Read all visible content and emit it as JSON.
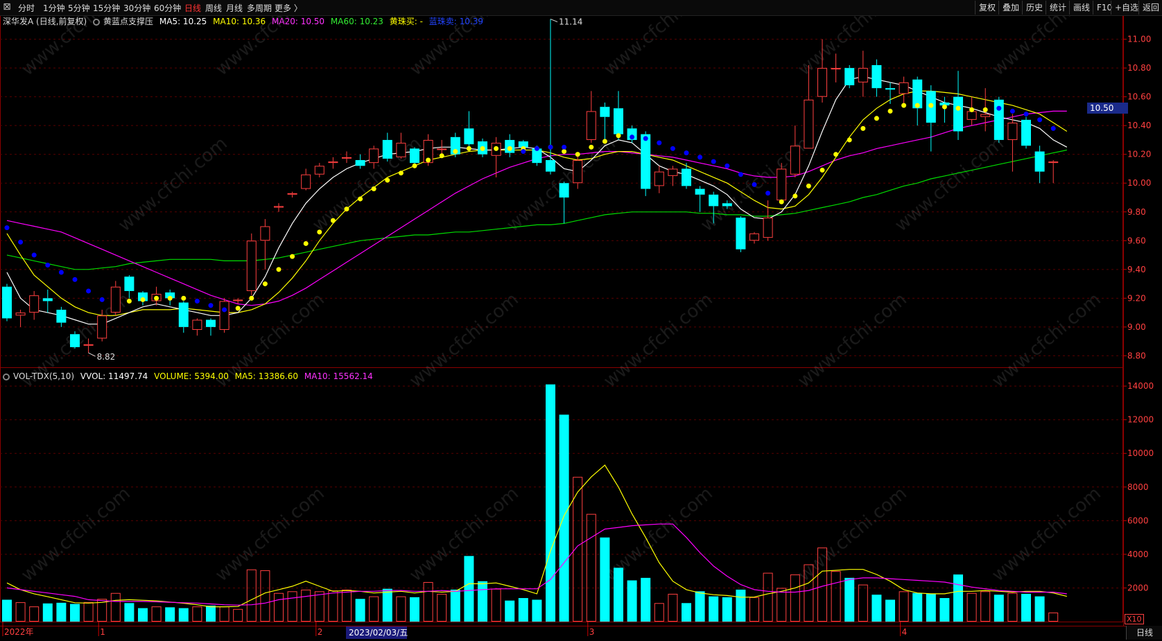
{
  "toolbar": {
    "left_items": [
      "分时",
      "1分钟",
      "5分钟",
      "15分钟",
      "30分钟",
      "60分钟",
      "日线",
      "周线",
      "月线",
      "多周期",
      "更多 〉"
    ],
    "active": "日线",
    "right_items": [
      "复权",
      "叠加",
      "历史",
      "统计",
      "画线",
      "F10",
      "+自选",
      "返回"
    ]
  },
  "price_panel": {
    "stock": "深华发A (日线,前复权)",
    "indicator": "黄蓝点支撑压",
    "ma5": "MA5: 10.25",
    "ma10": "MA10: 10.36",
    "ma20": "MA20: 10.50",
    "ma60": "MA60: 10.23",
    "yellow_buy": "黄珠买: -",
    "blue_sell": "蓝珠卖: 10.39",
    "current_price": "10.50",
    "high_label": "11.14",
    "low_label": "8.82",
    "y_ticks": [
      "11.00",
      "10.80",
      "10.60",
      "10.40",
      "10.20",
      "10.00",
      "9.80",
      "9.60",
      "9.40",
      "9.20",
      "9.00",
      "8.80"
    ]
  },
  "volume_panel": {
    "indicator": "VOL-TDX(5,10)",
    "vvol": "VVOL: 11497.74",
    "volume": "VOLUME: 5394.00",
    "ma5": "MA5: 13386.60",
    "ma10": "MA10: 15562.14",
    "y_ticks": [
      "14000",
      "12000",
      "10000",
      "8000",
      "6000",
      "4000",
      "2000"
    ],
    "x10_label": "X10"
  },
  "x_axis": {
    "labels": [
      "2022年",
      "1",
      "2",
      "3",
      "4"
    ],
    "cursor_date": "2023/02/03/五"
  },
  "bottom_tab": "日线",
  "watermark": "www.cfchi.com",
  "colors": {
    "up": "#ff4040",
    "down": "#00ffff",
    "ma5": "#ffffff",
    "ma10": "#ffff00",
    "ma20": "#ff00ff",
    "ma60": "#00dd00",
    "yellow_dot": "#ffff00",
    "blue_dot": "#0000ff"
  },
  "chart_data": {
    "type": "candlestick",
    "candles": [
      {
        "o": 9.28,
        "c": 9.06,
        "h": 9.3,
        "l": 9.04,
        "v": 1300
      },
      {
        "o": 9.08,
        "c": 9.1,
        "h": 9.12,
        "l": 9.0,
        "v": 1150
      },
      {
        "o": 9.1,
        "c": 9.22,
        "h": 9.25,
        "l": 9.05,
        "v": 900
      },
      {
        "o": 9.2,
        "c": 9.18,
        "h": 9.26,
        "l": 9.1,
        "v": 1080
      },
      {
        "o": 9.12,
        "c": 9.03,
        "h": 9.14,
        "l": 9.0,
        "v": 1120
      },
      {
        "o": 8.95,
        "c": 8.86,
        "h": 8.97,
        "l": 8.85,
        "v": 1050
      },
      {
        "o": 8.87,
        "c": 8.88,
        "h": 8.92,
        "l": 8.82,
        "v": 1160
      },
      {
        "o": 8.92,
        "c": 9.08,
        "h": 9.12,
        "l": 8.9,
        "v": 1350
      },
      {
        "o": 9.1,
        "c": 9.28,
        "h": 9.32,
        "l": 9.08,
        "v": 1700
      },
      {
        "o": 9.35,
        "c": 9.25,
        "h": 9.36,
        "l": 9.2,
        "v": 1100
      },
      {
        "o": 9.24,
        "c": 9.18,
        "h": 9.25,
        "l": 9.15,
        "v": 800
      },
      {
        "o": 9.18,
        "c": 9.23,
        "h": 9.28,
        "l": 9.15,
        "v": 900
      },
      {
        "o": 9.24,
        "c": 9.2,
        "h": 9.26,
        "l": 9.15,
        "v": 850
      },
      {
        "o": 9.17,
        "c": 9.0,
        "h": 9.18,
        "l": 8.96,
        "v": 800
      },
      {
        "o": 8.98,
        "c": 9.05,
        "h": 9.06,
        "l": 8.94,
        "v": 900
      },
      {
        "o": 9.05,
        "c": 9.0,
        "h": 9.06,
        "l": 8.94,
        "v": 950
      },
      {
        "o": 8.98,
        "c": 9.18,
        "h": 9.2,
        "l": 8.96,
        "v": 900
      },
      {
        "o": 9.18,
        "c": 9.19,
        "h": 9.2,
        "l": 9.16,
        "v": 750
      },
      {
        "o": 9.25,
        "c": 9.6,
        "h": 9.65,
        "l": 9.22,
        "v": 3100
      },
      {
        "o": 9.6,
        "c": 9.7,
        "h": 9.75,
        "l": 9.4,
        "v": 3050
      },
      {
        "o": 9.83,
        "c": 9.84,
        "h": 9.86,
        "l": 9.8,
        "v": 1700
      },
      {
        "o": 9.92,
        "c": 9.93,
        "h": 9.94,
        "l": 9.9,
        "v": 1800
      },
      {
        "o": 9.96,
        "c": 10.06,
        "h": 10.1,
        "l": 9.95,
        "v": 1900
      },
      {
        "o": 10.06,
        "c": 10.12,
        "h": 10.14,
        "l": 10.04,
        "v": 1800
      },
      {
        "o": 10.14,
        "c": 10.15,
        "h": 10.18,
        "l": 10.1,
        "v": 1850
      },
      {
        "o": 10.18,
        "c": 10.18,
        "h": 10.22,
        "l": 10.14,
        "v": 1900
      },
      {
        "o": 10.16,
        "c": 10.12,
        "h": 10.2,
        "l": 10.1,
        "v": 1350
      },
      {
        "o": 10.14,
        "c": 10.24,
        "h": 10.26,
        "l": 10.1,
        "v": 1500
      },
      {
        "o": 10.3,
        "c": 10.17,
        "h": 10.35,
        "l": 10.15,
        "v": 1950
      },
      {
        "o": 10.18,
        "c": 10.28,
        "h": 10.35,
        "l": 10.17,
        "v": 1500
      },
      {
        "o": 10.24,
        "c": 10.14,
        "h": 10.25,
        "l": 10.13,
        "v": 1450
      },
      {
        "o": 10.14,
        "c": 10.3,
        "h": 10.34,
        "l": 10.12,
        "v": 2350
      },
      {
        "o": 10.23,
        "c": 10.24,
        "h": 10.3,
        "l": 10.2,
        "v": 1650
      },
      {
        "o": 10.32,
        "c": 10.2,
        "h": 10.35,
        "l": 10.18,
        "v": 1900
      },
      {
        "o": 10.38,
        "c": 10.27,
        "h": 10.5,
        "l": 10.25,
        "v": 3900
      },
      {
        "o": 10.29,
        "c": 10.2,
        "h": 10.31,
        "l": 10.18,
        "v": 2400
      },
      {
        "o": 10.19,
        "c": 10.28,
        "h": 10.32,
        "l": 10.04,
        "v": 1950
      },
      {
        "o": 10.3,
        "c": 10.21,
        "h": 10.34,
        "l": 10.18,
        "v": 1250
      },
      {
        "o": 10.29,
        "c": 10.25,
        "h": 10.3,
        "l": 10.23,
        "v": 1400
      },
      {
        "o": 10.24,
        "c": 10.14,
        "h": 10.26,
        "l": 10.12,
        "v": 1300
      },
      {
        "o": 10.16,
        "c": 10.08,
        "h": 11.14,
        "l": 10.06,
        "v": 14100
      },
      {
        "o": 10.0,
        "c": 9.9,
        "h": 10.01,
        "l": 9.72,
        "v": 12300
      },
      {
        "o": 10.0,
        "c": 10.16,
        "h": 10.2,
        "l": 9.96,
        "v": 8600
      },
      {
        "o": 10.3,
        "c": 10.5,
        "h": 10.64,
        "l": 10.28,
        "v": 6400
      },
      {
        "o": 10.53,
        "c": 10.46,
        "h": 10.56,
        "l": 10.3,
        "v": 5000
      },
      {
        "o": 10.52,
        "c": 10.34,
        "h": 10.64,
        "l": 10.3,
        "v": 3200
      },
      {
        "o": 10.38,
        "c": 10.3,
        "h": 10.4,
        "l": 10.28,
        "v": 2450
      },
      {
        "o": 10.34,
        "c": 9.96,
        "h": 10.36,
        "l": 9.91,
        "v": 2600
      },
      {
        "o": 9.98,
        "c": 10.08,
        "h": 10.12,
        "l": 9.93,
        "v": 1100
      },
      {
        "o": 10.05,
        "c": 10.1,
        "h": 10.12,
        "l": 9.98,
        "v": 1650
      },
      {
        "o": 10.1,
        "c": 9.98,
        "h": 10.14,
        "l": 9.96,
        "v": 1100
      },
      {
        "o": 9.96,
        "c": 9.92,
        "h": 9.98,
        "l": 9.8,
        "v": 1800
      },
      {
        "o": 9.92,
        "c": 9.84,
        "h": 9.94,
        "l": 9.72,
        "v": 1500
      },
      {
        "o": 9.86,
        "c": 9.84,
        "h": 9.88,
        "l": 9.82,
        "v": 1450
      },
      {
        "o": 9.76,
        "c": 9.54,
        "h": 9.77,
        "l": 9.52,
        "v": 1900
      },
      {
        "o": 9.6,
        "c": 9.65,
        "h": 9.66,
        "l": 9.58,
        "v": 1450
      },
      {
        "o": 9.62,
        "c": 9.76,
        "h": 9.88,
        "l": 9.6,
        "v": 2900
      },
      {
        "o": 9.88,
        "c": 10.1,
        "h": 10.14,
        "l": 9.86,
        "v": 2000
      },
      {
        "o": 10.06,
        "c": 10.26,
        "h": 10.4,
        "l": 10.04,
        "v": 2800
      },
      {
        "o": 10.24,
        "c": 10.58,
        "h": 10.82,
        "l": 10.24,
        "v": 3400
      },
      {
        "o": 10.6,
        "c": 10.8,
        "h": 11.0,
        "l": 10.56,
        "v": 4400
      },
      {
        "o": 10.8,
        "c": 10.8,
        "h": 10.9,
        "l": 10.7,
        "v": 3000
      },
      {
        "o": 10.8,
        "c": 10.68,
        "h": 10.82,
        "l": 10.66,
        "v": 2600
      },
      {
        "o": 10.7,
        "c": 10.8,
        "h": 10.92,
        "l": 10.6,
        "v": 2200
      },
      {
        "o": 10.82,
        "c": 10.66,
        "h": 10.86,
        "l": 10.6,
        "v": 1600
      },
      {
        "o": 10.66,
        "c": 10.65,
        "h": 10.7,
        "l": 10.55,
        "v": 1300
      },
      {
        "o": 10.62,
        "c": 10.7,
        "h": 10.74,
        "l": 10.54,
        "v": 1800
      },
      {
        "o": 10.72,
        "c": 10.52,
        "h": 10.74,
        "l": 10.4,
        "v": 1700
      },
      {
        "o": 10.64,
        "c": 10.42,
        "h": 10.68,
        "l": 10.22,
        "v": 1650
      },
      {
        "o": 10.56,
        "c": 10.54,
        "h": 10.6,
        "l": 10.42,
        "v": 1400
      },
      {
        "o": 10.6,
        "c": 10.36,
        "h": 10.78,
        "l": 10.3,
        "v": 2800
      },
      {
        "o": 10.44,
        "c": 10.5,
        "h": 10.6,
        "l": 10.4,
        "v": 1700
      },
      {
        "o": 10.46,
        "c": 10.48,
        "h": 10.66,
        "l": 10.36,
        "v": 1800
      },
      {
        "o": 10.58,
        "c": 10.3,
        "h": 10.6,
        "l": 10.28,
        "v": 1600
      },
      {
        "o": 10.3,
        "c": 10.42,
        "h": 10.48,
        "l": 10.08,
        "v": 1700
      },
      {
        "o": 10.44,
        "c": 10.26,
        "h": 10.46,
        "l": 10.24,
        "v": 1650
      },
      {
        "o": 10.22,
        "c": 10.08,
        "h": 10.26,
        "l": 10.0,
        "v": 1500
      },
      {
        "o": 10.14,
        "c": 10.15,
        "h": 10.16,
        "l": 10.0,
        "v": 539
      }
    ],
    "ma5": [
      9.38,
      9.2,
      9.12,
      9.1,
      9.08,
      9.05,
      9.02,
      9.02,
      9.06,
      9.1,
      9.14,
      9.16,
      9.14,
      9.12,
      9.1,
      9.08,
      9.08,
      9.1,
      9.2,
      9.35,
      9.55,
      9.72,
      9.86,
      9.96,
      10.04,
      10.1,
      10.14,
      10.17,
      10.2,
      10.21,
      10.22,
      10.24,
      10.25,
      10.25,
      10.24,
      10.23,
      10.23,
      10.24,
      10.25,
      10.24,
      10.18,
      10.1,
      10.08,
      10.16,
      10.26,
      10.3,
      10.28,
      10.2,
      10.12,
      10.08,
      10.06,
      10.02,
      9.98,
      9.92,
      9.82,
      9.76,
      9.75,
      9.8,
      9.92,
      10.12,
      10.36,
      10.58,
      10.72,
      10.74,
      10.72,
      10.7,
      10.68,
      10.64,
      10.6,
      10.56,
      10.54,
      10.52,
      10.49,
      10.46,
      10.44,
      10.42,
      10.38,
      10.3,
      10.25
    ],
    "ma10": [
      9.65,
      9.5,
      9.36,
      9.28,
      9.2,
      9.14,
      9.1,
      9.08,
      9.08,
      9.1,
      9.12,
      9.12,
      9.12,
      9.13,
      9.12,
      9.11,
      9.1,
      9.1,
      9.12,
      9.16,
      9.24,
      9.34,
      9.46,
      9.6,
      9.72,
      9.82,
      9.9,
      9.97,
      10.04,
      10.08,
      10.12,
      10.16,
      10.18,
      10.2,
      10.22,
      10.23,
      10.23,
      10.23,
      10.23,
      10.23,
      10.21,
      10.18,
      10.16,
      10.17,
      10.2,
      10.22,
      10.22,
      10.2,
      10.18,
      10.16,
      10.12,
      10.08,
      10.04,
      10.0,
      9.94,
      9.88,
      9.83,
      9.82,
      9.84,
      9.92,
      10.04,
      10.18,
      10.32,
      10.44,
      10.52,
      10.58,
      10.62,
      10.64,
      10.64,
      10.63,
      10.62,
      10.6,
      10.58,
      10.56,
      10.54,
      10.51,
      10.48,
      10.42,
      10.36
    ],
    "ma20": [
      9.74,
      9.72,
      9.7,
      9.68,
      9.66,
      9.62,
      9.58,
      9.54,
      9.5,
      9.46,
      9.42,
      9.38,
      9.34,
      9.3,
      9.26,
      9.22,
      9.19,
      9.16,
      9.15,
      9.16,
      9.18,
      9.22,
      9.27,
      9.33,
      9.39,
      9.45,
      9.51,
      9.57,
      9.63,
      9.69,
      9.75,
      9.81,
      9.87,
      9.93,
      9.98,
      10.03,
      10.07,
      10.11,
      10.14,
      10.17,
      10.19,
      10.2,
      10.2,
      10.21,
      10.22,
      10.22,
      10.21,
      10.2,
      10.19,
      10.18,
      10.16,
      10.14,
      10.12,
      10.1,
      10.07,
      10.05,
      10.04,
      10.04,
      10.05,
      10.08,
      10.12,
      10.16,
      10.19,
      10.21,
      10.24,
      10.26,
      10.28,
      10.3,
      10.32,
      10.35,
      10.38,
      10.4,
      10.42,
      10.44,
      10.46,
      10.48,
      10.49,
      10.5,
      10.5
    ],
    "ma60": [
      9.5,
      9.48,
      9.46,
      9.44,
      9.42,
      9.4,
      9.4,
      9.41,
      9.42,
      9.44,
      9.45,
      9.46,
      9.47,
      9.47,
      9.47,
      9.47,
      9.46,
      9.46,
      9.46,
      9.47,
      9.48,
      9.5,
      9.52,
      9.54,
      9.56,
      9.58,
      9.6,
      9.61,
      9.62,
      9.63,
      9.64,
      9.64,
      9.65,
      9.66,
      9.66,
      9.67,
      9.68,
      9.69,
      9.7,
      9.71,
      9.71,
      9.72,
      9.74,
      9.76,
      9.78,
      9.79,
      9.8,
      9.8,
      9.8,
      9.8,
      9.8,
      9.79,
      9.79,
      9.78,
      9.78,
      9.77,
      9.77,
      9.78,
      9.79,
      9.81,
      9.83,
      9.85,
      9.87,
      9.9,
      9.92,
      9.95,
      9.98,
      10.0,
      10.03,
      10.05,
      10.07,
      10.09,
      10.11,
      10.13,
      10.15,
      10.17,
      10.19,
      10.21,
      10.23
    ],
    "vol_ma5": [
      2300,
      1900,
      1650,
      1480,
      1300,
      1120,
      1100,
      1140,
      1260,
      1300,
      1270,
      1230,
      1160,
      1090,
      1000,
      880,
      880,
      900,
      1300,
      1700,
      1900,
      2100,
      2400,
      2100,
      1800,
      1850,
      1800,
      1700,
      1750,
      1800,
      1700,
      1800,
      1750,
      1800,
      2250,
      2250,
      2300,
      2100,
      1900,
      1650,
      4200,
      6300,
      7700,
      8600,
      9300,
      8000,
      6400,
      5000,
      3500,
      2400,
      1900,
      1700,
      1600,
      1550,
      1450,
      1460,
      1650,
      1800,
      2000,
      2300,
      3000,
      3050,
      3100,
      3100,
      2800,
      2400,
      1900,
      1700,
      1650,
      1650,
      1800,
      1800,
      1850,
      1800,
      1750,
      1800,
      1800,
      1700,
      1500
    ],
    "vol_ma10": [
      2000,
      1900,
      1800,
      1700,
      1600,
      1500,
      1300,
      1250,
      1200,
      1200,
      1200,
      1180,
      1150,
      1120,
      1100,
      1050,
      1000,
      980,
      1000,
      1100,
      1300,
      1400,
      1500,
      1600,
      1700,
      1750,
      1800,
      1800,
      1850,
      1850,
      1800,
      1800,
      1850,
      1800,
      1850,
      1900,
      1950,
      1950,
      1950,
      1950,
      2500,
      3500,
      4500,
      5000,
      5500,
      5600,
      5700,
      5750,
      5800,
      5800,
      5000,
      4100,
      3300,
      2700,
      2200,
      1900,
      1800,
      1750,
      1750,
      1850,
      2100,
      2300,
      2500,
      2600,
      2600,
      2550,
      2500,
      2450,
      2400,
      2350,
      2200,
      2050,
      1950,
      1850,
      1800,
      1750,
      1750,
      1750,
      1650
    ],
    "yellow_dots": [
      [
        9,
        9.18
      ],
      [
        10,
        9.19
      ],
      [
        11,
        9.2
      ],
      [
        12,
        9.2
      ],
      [
        13,
        9.2
      ],
      [
        17,
        9.13
      ],
      [
        18,
        9.2
      ],
      [
        19,
        9.3
      ],
      [
        20,
        9.4
      ],
      [
        21,
        9.49
      ],
      [
        22,
        9.58
      ],
      [
        23,
        9.66
      ],
      [
        24,
        9.74
      ],
      [
        25,
        9.82
      ],
      [
        26,
        9.89
      ],
      [
        27,
        9.96
      ],
      [
        28,
        10.02
      ],
      [
        29,
        10.07
      ],
      [
        30,
        10.12
      ],
      [
        31,
        10.16
      ],
      [
        32,
        10.19
      ],
      [
        33,
        10.22
      ],
      [
        34,
        10.24
      ],
      [
        35,
        10.24
      ],
      [
        36,
        10.24
      ],
      [
        37,
        10.24
      ],
      [
        38,
        10.24
      ],
      [
        39,
        10.24
      ],
      [
        40,
        10.25
      ],
      [
        41,
        10.22
      ],
      [
        42,
        10.2
      ],
      [
        43,
        10.25
      ],
      [
        44,
        10.29
      ],
      [
        45,
        10.33
      ],
      [
        57,
        9.87
      ],
      [
        58,
        9.91
      ],
      [
        59,
        9.98
      ],
      [
        60,
        10.09
      ],
      [
        61,
        10.2
      ],
      [
        62,
        10.3
      ],
      [
        63,
        10.38
      ],
      [
        64,
        10.45
      ],
      [
        65,
        10.5
      ],
      [
        66,
        10.54
      ],
      [
        67,
        10.54
      ],
      [
        68,
        10.54
      ],
      [
        69,
        10.53
      ],
      [
        70,
        10.52
      ],
      [
        71,
        10.51
      ],
      [
        72,
        10.51
      ]
    ],
    "blue_dots": [
      [
        0,
        9.69
      ],
      [
        1,
        9.59
      ],
      [
        2,
        9.5
      ],
      [
        3,
        9.43
      ],
      [
        4,
        9.38
      ],
      [
        5,
        9.33
      ],
      [
        6,
        9.25
      ],
      [
        7,
        9.19
      ],
      [
        14,
        9.18
      ],
      [
        15,
        9.15
      ],
      [
        16,
        9.12
      ],
      [
        38,
        10.22
      ],
      [
        39,
        10.24
      ],
      [
        40,
        10.25
      ],
      [
        41,
        10.25
      ],
      [
        46,
        10.32
      ],
      [
        47,
        10.31
      ],
      [
        48,
        10.28
      ],
      [
        49,
        10.24
      ],
      [
        50,
        10.21
      ],
      [
        51,
        10.18
      ],
      [
        52,
        10.15
      ],
      [
        53,
        10.12
      ],
      [
        54,
        10.06
      ],
      [
        55,
        9.99
      ],
      [
        56,
        9.93
      ],
      [
        73,
        10.52
      ],
      [
        74,
        10.5
      ],
      [
        75,
        10.48
      ],
      [
        76,
        10.44
      ],
      [
        77,
        10.38
      ]
    ],
    "ylim": [
      8.72,
      11.08
    ],
    "vol_ylim": [
      0,
      14500
    ]
  }
}
